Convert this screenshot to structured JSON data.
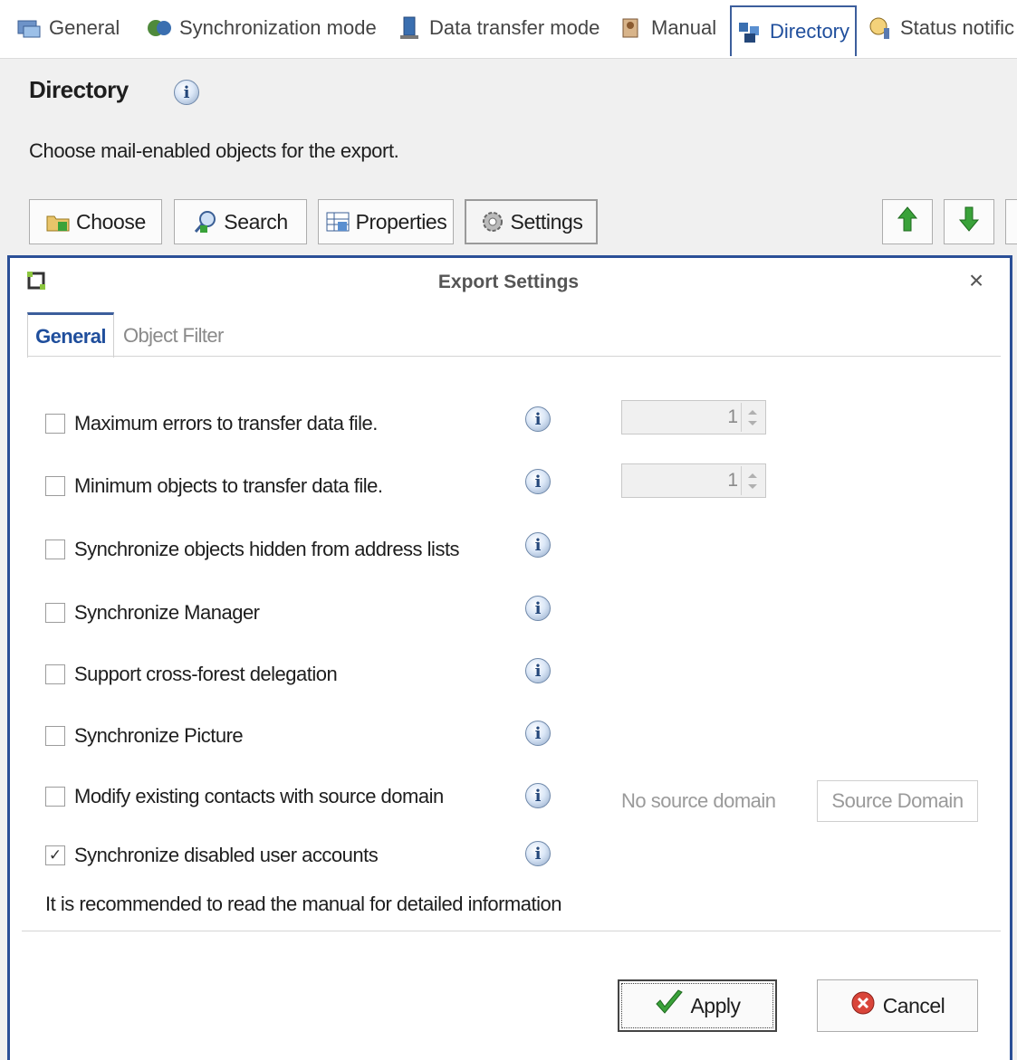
{
  "tabs": [
    {
      "label": "General",
      "icon": "general-icon"
    },
    {
      "label": "Synchronization mode",
      "icon": "sync-mode-icon"
    },
    {
      "label": "Data transfer mode",
      "icon": "data-transfer-icon"
    },
    {
      "label": "Manual",
      "icon": "manual-icon"
    },
    {
      "label": "Directory",
      "icon": "directory-icon",
      "active": true
    },
    {
      "label": "Status notific",
      "icon": "status-icon"
    }
  ],
  "page": {
    "title": "Directory",
    "description": "Choose mail-enabled objects for the export."
  },
  "toolbar": {
    "choose": "Choose",
    "search": "Search",
    "properties": "Properties",
    "settings": "Settings"
  },
  "dialog": {
    "title": "Export Settings",
    "close": "×",
    "tabs": {
      "general": "General",
      "object_filter": "Object Filter"
    },
    "options": [
      {
        "label": "Maximum errors to transfer data file.",
        "checked": false
      },
      {
        "label": "Minimum objects to transfer data file.",
        "checked": false
      },
      {
        "label": "Synchronize objects hidden from address lists",
        "checked": false
      },
      {
        "label": "Synchronize Manager",
        "checked": false
      },
      {
        "label": "Support cross-forest delegation",
        "checked": false
      },
      {
        "label": "Synchronize Picture",
        "checked": false
      },
      {
        "label": "Modify existing contacts with source domain",
        "checked": false
      },
      {
        "label": "Synchronize disabled user accounts",
        "checked": true
      }
    ],
    "max_errors_value": "1",
    "min_objects_value": "1",
    "no_source_domain": "No source domain",
    "source_domain_button": "Source Domain",
    "note": "It is recommended to read the manual for detailed information",
    "apply": "Apply",
    "cancel": "Cancel",
    "info_glyph": "i",
    "check_glyph": "✓"
  },
  "colors": {
    "accent": "#2a4f97",
    "active_tab_text": "#1f4e9c",
    "arrow_green": "#3aa23a"
  }
}
